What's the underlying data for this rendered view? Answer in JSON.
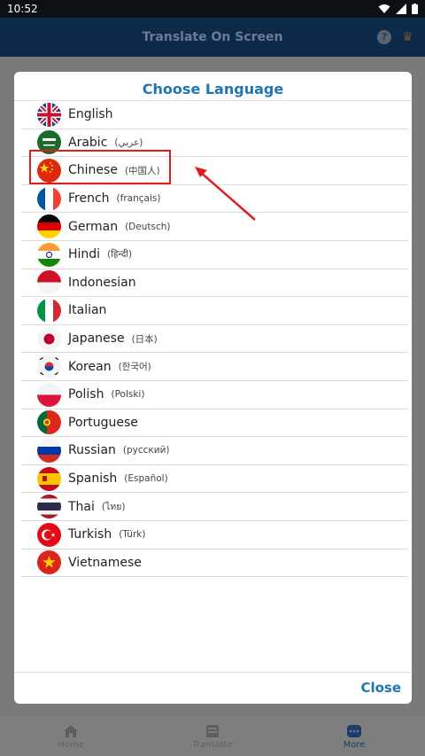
{
  "status_bar": {
    "time": "10:52"
  },
  "app": {
    "title": "Translate On Screen",
    "nav": [
      {
        "label": "Home",
        "icon": "home-icon"
      },
      {
        "label": "Translate",
        "icon": "translate-icon"
      },
      {
        "label": "More",
        "icon": "more-icon",
        "active": true
      }
    ]
  },
  "dialog": {
    "title": "Choose Language",
    "close_label": "Close",
    "languages": [
      {
        "name": "English",
        "native": "",
        "flag": "uk-flag-icon"
      },
      {
        "name": "Arabic",
        "native": "(عربي)",
        "flag": "saudi-flag-icon"
      },
      {
        "name": "Chinese",
        "native": "(中国人)",
        "flag": "china-flag-icon"
      },
      {
        "name": "French",
        "native": "(français)",
        "flag": "france-flag-icon"
      },
      {
        "name": "German",
        "native": "(Deutsch)",
        "flag": "germany-flag-icon"
      },
      {
        "name": "Hindi",
        "native": "(हिन्दी)",
        "flag": "india-flag-icon"
      },
      {
        "name": "Indonesian",
        "native": "",
        "flag": "indonesia-flag-icon"
      },
      {
        "name": "Italian",
        "native": "",
        "flag": "italy-flag-icon"
      },
      {
        "name": "Japanese",
        "native": "(日本)",
        "flag": "japan-flag-icon"
      },
      {
        "name": "Korean",
        "native": "(한국어)",
        "flag": "korea-flag-icon"
      },
      {
        "name": "Polish",
        "native": "(Polski)",
        "flag": "poland-flag-icon"
      },
      {
        "name": "Portuguese",
        "native": "",
        "flag": "portugal-flag-icon"
      },
      {
        "name": "Russian",
        "native": "(русский)",
        "flag": "russia-flag-icon"
      },
      {
        "name": "Spanish",
        "native": "(Español)",
        "flag": "spain-flag-icon"
      },
      {
        "name": "Thai",
        "native": "(ไทย)",
        "flag": "thailand-flag-icon"
      },
      {
        "name": "Turkish",
        "native": "(Türk)",
        "flag": "turkey-flag-icon"
      },
      {
        "name": "Vietnamese",
        "native": "",
        "flag": "vietnam-flag-icon"
      }
    ]
  },
  "colors": {
    "accent": "#1f75b3",
    "highlight": "#e21b1b"
  }
}
